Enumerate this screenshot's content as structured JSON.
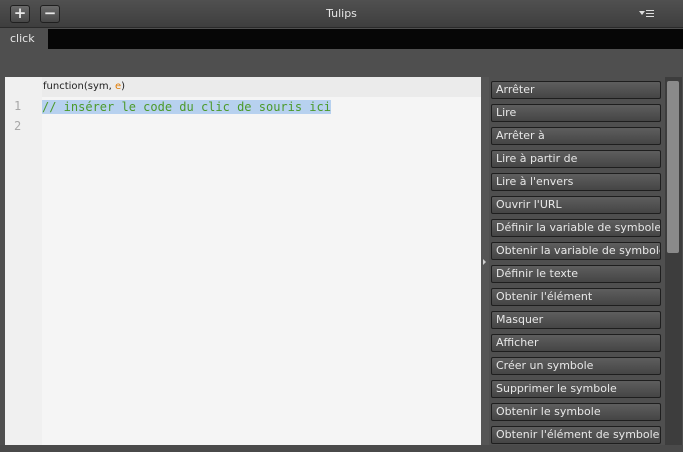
{
  "window": {
    "title": "Tulips",
    "add_label": "+",
    "remove_label": "−"
  },
  "tabs": [
    {
      "label": "click"
    }
  ],
  "editor": {
    "signature_prefix": "function(sym, ",
    "signature_param": "e",
    "signature_suffix": ")",
    "line_numbers": [
      "1",
      "2"
    ],
    "lines": [
      "// insérer le code du clic de souris ici",
      ""
    ]
  },
  "snippets": [
    "Arrêter",
    "Lire",
    "Arrêter à",
    "Lire à partir de",
    "Lire à l'envers",
    "Ouvrir l'URL",
    "Définir la variable de symbole",
    "Obtenir la variable de symbole",
    "Définir le texte",
    "Obtenir l'élément",
    "Masquer",
    "Afficher",
    "Créer un symbole",
    "Supprimer le symbole",
    "Obtenir le symbole",
    "Obtenir l'élément de symbole"
  ],
  "colors": {
    "comment_text": "#4c9a2a",
    "selection": "#b7d1ef",
    "param_highlight": "#e07a00"
  }
}
